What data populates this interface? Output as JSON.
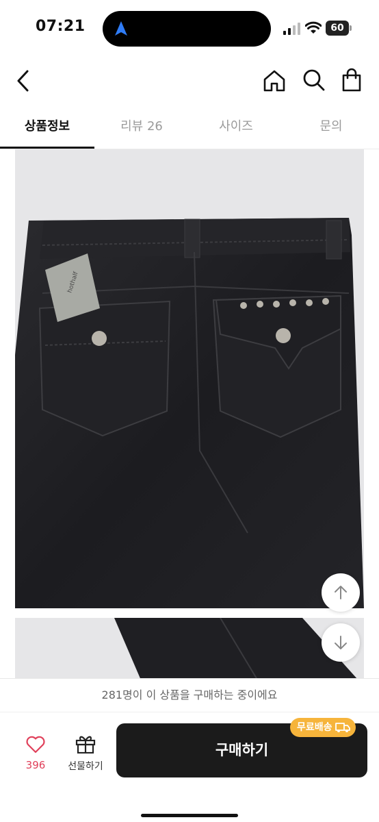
{
  "status_bar": {
    "time": "07:21",
    "battery": "60"
  },
  "header": {
    "icons": [
      "back-icon",
      "home-icon",
      "search-icon",
      "shopping-bag-icon"
    ]
  },
  "tabs": [
    {
      "label": "상품정보",
      "active": true
    },
    {
      "label": "리뷰 26",
      "active": false
    },
    {
      "label": "사이즈",
      "active": false
    },
    {
      "label": "문의",
      "active": false
    }
  ],
  "product": {
    "tag_text": "hothalf"
  },
  "notice": {
    "text": "281명이 이 상품을 구매하는 중이에요"
  },
  "bottom_bar": {
    "like_count": "396",
    "gift_label": "선물하기",
    "buy_label": "구매하기",
    "free_shipping_badge": "무료배송"
  },
  "colors": {
    "accent": "#e0405a",
    "badge": "#f6b43b",
    "buy_button": "#1b1b1b"
  }
}
